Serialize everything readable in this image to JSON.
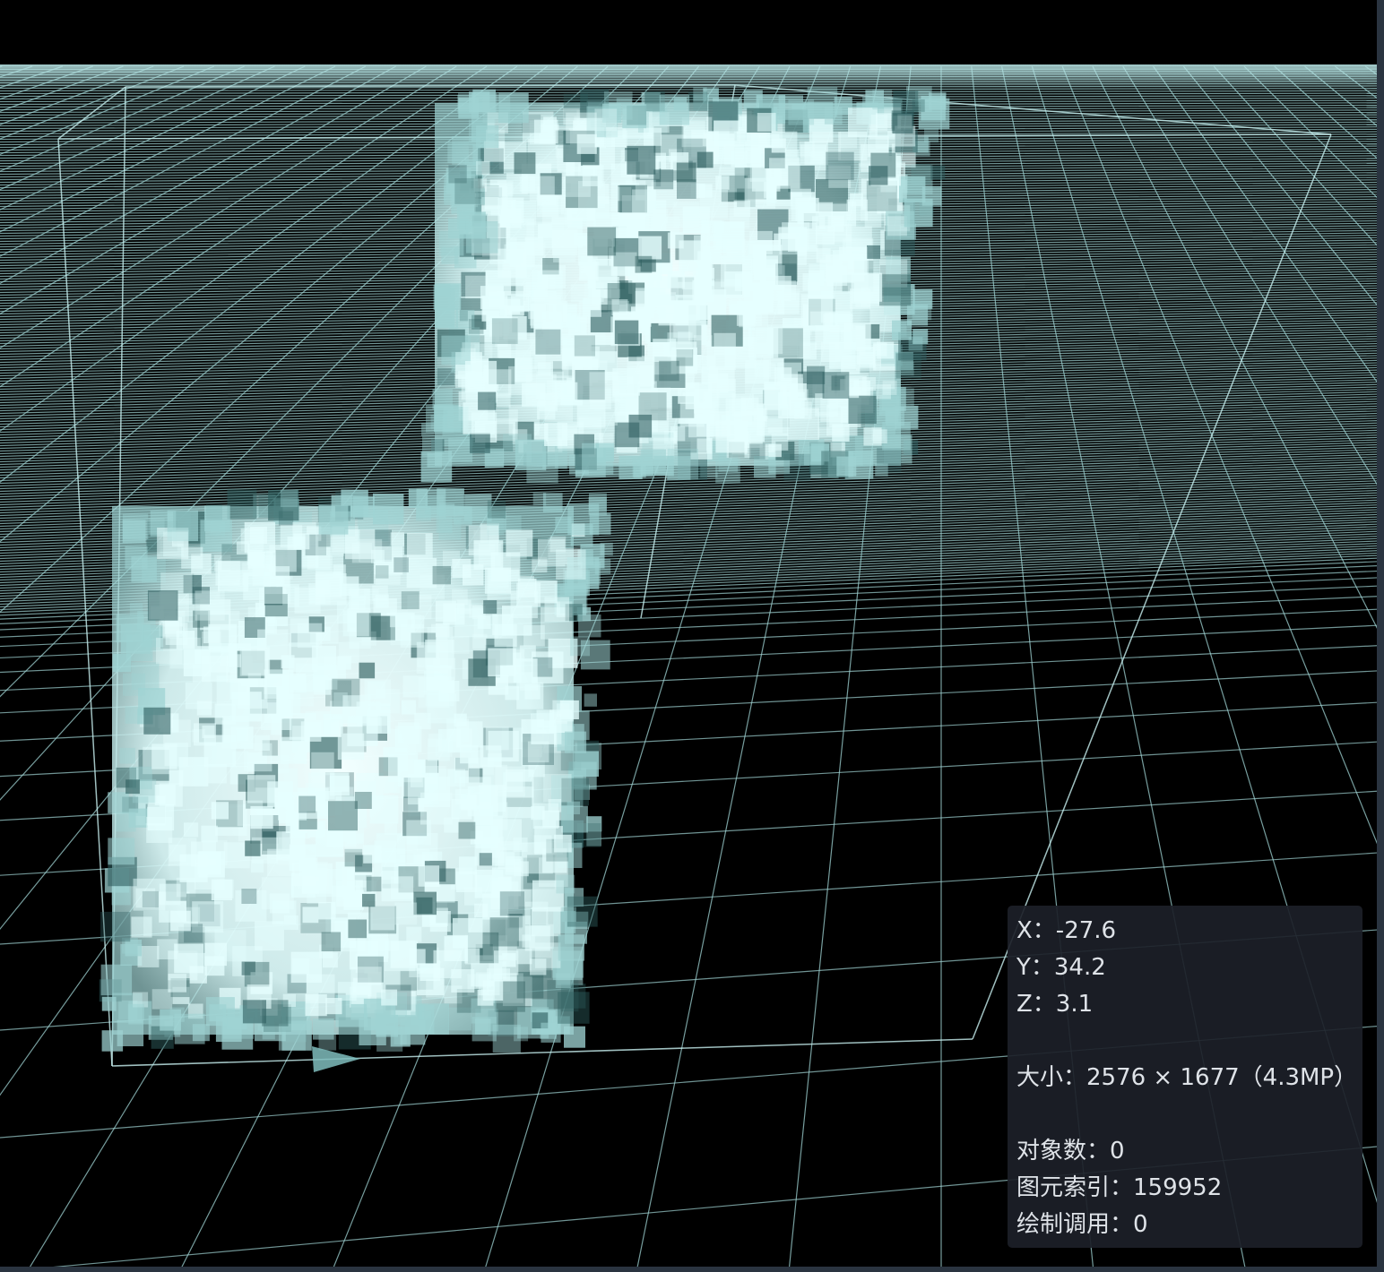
{
  "viewport": {
    "background": "#000000",
    "grid_color": "#9fd3d3",
    "voxel_color": "#e6ffff"
  },
  "info_panel": {
    "x": "X：-27.6",
    "y": "Y：34.2",
    "z": "Z：3.1",
    "size": "大小：2576 × 1677（4.3MP）",
    "object_count": "对象数：0",
    "primitive_index": "图元索引：159952",
    "draw_calls": "绘制调用：0"
  }
}
